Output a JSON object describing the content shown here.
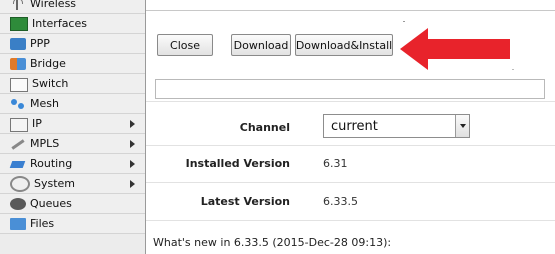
{
  "sidebar": {
    "items": [
      {
        "label": "Wireless",
        "icon": "wireless-icon",
        "submenu": false
      },
      {
        "label": "Interfaces",
        "icon": "interfaces-icon",
        "submenu": false
      },
      {
        "label": "PPP",
        "icon": "ppp-icon",
        "submenu": false
      },
      {
        "label": "Bridge",
        "icon": "bridge-icon",
        "submenu": false
      },
      {
        "label": "Switch",
        "icon": "switch-icon",
        "submenu": false
      },
      {
        "label": "Mesh",
        "icon": "mesh-icon",
        "submenu": false
      },
      {
        "label": "IP",
        "icon": "ip-icon",
        "submenu": true
      },
      {
        "label": "MPLS",
        "icon": "mpls-icon",
        "submenu": true
      },
      {
        "label": "Routing",
        "icon": "routing-icon",
        "submenu": true
      },
      {
        "label": "System",
        "icon": "system-icon",
        "submenu": true
      },
      {
        "label": "Queues",
        "icon": "queues-icon",
        "submenu": false
      },
      {
        "label": "Files",
        "icon": "files-icon",
        "submenu": false
      }
    ]
  },
  "toolbar": {
    "close_label": "Close",
    "download_label": "Download",
    "download_install_label": "Download&Install"
  },
  "annotation": {
    "arrow_color": "#e8232b"
  },
  "form": {
    "channel_label": "Channel",
    "channel_value": "current",
    "installed_label": "Installed Version",
    "installed_value": "6.31",
    "latest_label": "Latest Version",
    "latest_value": "6.33.5"
  },
  "whats_new": "What's new in 6.33.5 (2015-Dec-28 09:13):"
}
